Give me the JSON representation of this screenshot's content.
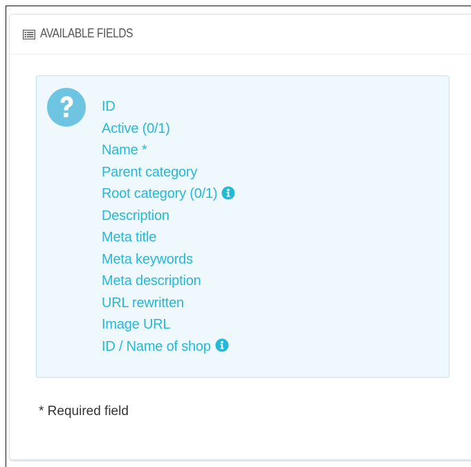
{
  "panel": {
    "heading_title": "AVAILABLE FIELDS",
    "heading_icon": "list-alt-icon"
  },
  "alert": {
    "icon": "question-circle-icon",
    "fields": [
      {
        "label": "ID",
        "info": false
      },
      {
        "label": "Active (0/1)",
        "info": false
      },
      {
        "label": "Name *",
        "info": false
      },
      {
        "label": "Parent category",
        "info": false
      },
      {
        "label": "Root category (0/1)",
        "info": true
      },
      {
        "label": "Description",
        "info": false
      },
      {
        "label": "Meta title",
        "info": false
      },
      {
        "label": "Meta keywords",
        "info": false
      },
      {
        "label": "Meta description",
        "info": false
      },
      {
        "label": "URL rewritten",
        "info": false
      },
      {
        "label": "Image URL",
        "info": false
      },
      {
        "label": "ID / Name of shop",
        "info": true
      }
    ]
  },
  "footnote": "* Required field",
  "colors": {
    "link": "#25b9d7",
    "alert_background": "#eef8fd",
    "alert_border": "#bfe3f2",
    "help_icon": "#6ec5e2",
    "info_icon": "#25b9d7"
  }
}
